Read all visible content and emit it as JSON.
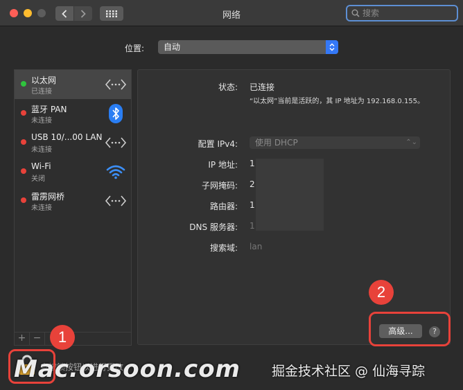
{
  "window": {
    "title": "网络"
  },
  "search": {
    "placeholder": "搜索"
  },
  "location": {
    "label": "位置:",
    "value": "自动"
  },
  "services": [
    {
      "name": "以太网",
      "status": "已连接",
      "dot": "#2fc43d",
      "icon": "ethernet-icon"
    },
    {
      "name": "蓝牙 PAN",
      "status": "未连接",
      "dot": "#e8423a",
      "icon": "bluetooth-icon"
    },
    {
      "name": "USB 10/...00 LAN",
      "status": "未连接",
      "dot": "#e8423a",
      "icon": "ethernet-icon"
    },
    {
      "name": "Wi-Fi",
      "status": "关闭",
      "dot": "#e8423a",
      "icon": "wifi-icon"
    },
    {
      "name": "雷雳网桥",
      "status": "未连接",
      "dot": "#e8423a",
      "icon": "ethernet-icon"
    }
  ],
  "sidebar_buttons": {
    "add": "+",
    "remove": "−"
  },
  "detail": {
    "status_label": "状态:",
    "status_value": "已连接",
    "status_desc": "“以太网”当前是活跃的，其 IP 地址为 192.168.0.155。",
    "ipv4_label": "配置 IPv4:",
    "ipv4_value": "使用 DHCP",
    "ip_label": "IP 地址:",
    "ip_value": "1",
    "subnet_label": "子网掩码:",
    "subnet_value": "2",
    "router_label": "路由器:",
    "router_value": "1",
    "dns_label": "DNS 服务器:",
    "dns_value": "1",
    "searchdomain_label": "搜索域:",
    "searchdomain_value": "lan",
    "advanced_button": "高级...",
    "help_button": "?"
  },
  "lock": {
    "text": "点按锁按钮以进行更改。"
  },
  "annotations": {
    "badge1": "1",
    "badge2": "2"
  },
  "watermarks": {
    "left": "Mac.orsoon.com",
    "right": "掘金技术社区 @ 仙海寻踪"
  },
  "colors": {
    "accent": "#3478f6",
    "annotation": "#e8423a",
    "connected": "#2fc43d"
  }
}
